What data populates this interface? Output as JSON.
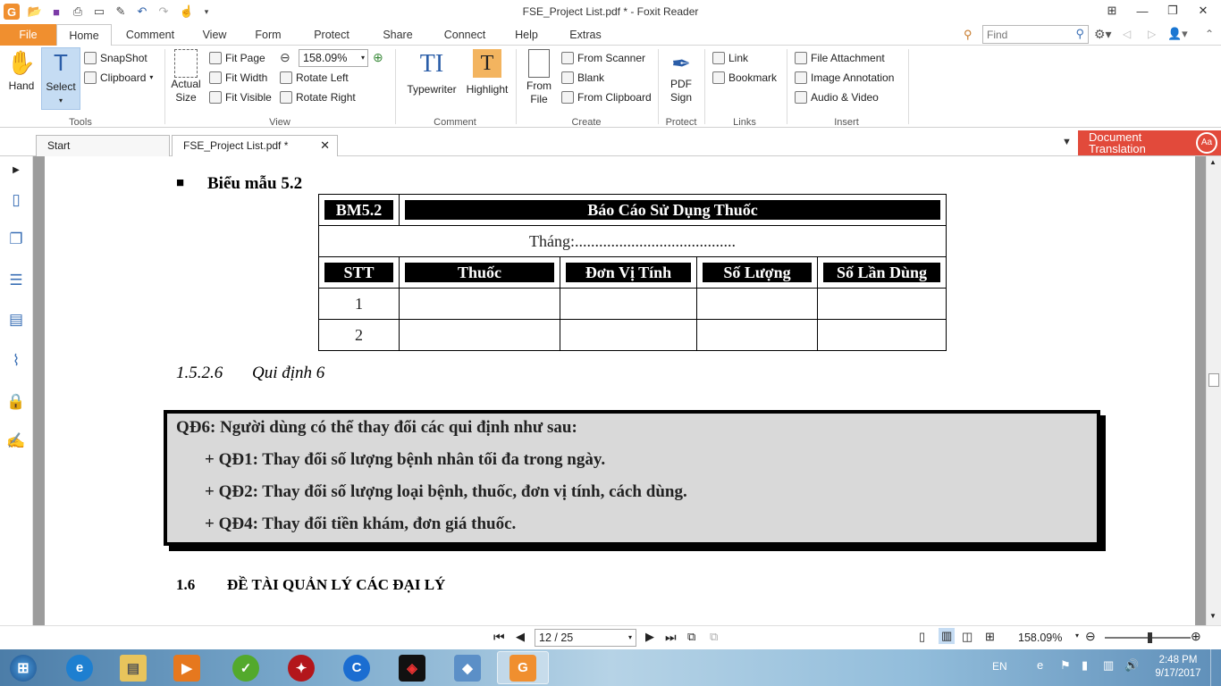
{
  "window": {
    "title": "FSE_Project List.pdf * - Foxit Reader"
  },
  "menu": {
    "tabs": [
      "File",
      "Home",
      "Comment",
      "View",
      "Form",
      "Protect",
      "Share",
      "Connect",
      "Help",
      "Extras"
    ],
    "find_placeholder": "Find"
  },
  "ribbon": {
    "hand": "Hand",
    "select": "Select",
    "snapshot": "SnapShot",
    "clipboard": "Clipboard",
    "actual_size_l1": "Actual",
    "actual_size_l2": "Size",
    "fit_page": "Fit Page",
    "fit_width": "Fit Width",
    "fit_visible": "Fit Visible",
    "zoom_value": "158.09%",
    "rotate_left": "Rotate Left",
    "rotate_right": "Rotate Right",
    "typewriter": "Typewriter",
    "highlight": "Highlight",
    "from_file_l1": "From",
    "from_file_l2": "File",
    "from_scanner": "From Scanner",
    "blank": "Blank",
    "from_clipboard": "From Clipboard",
    "pdf_sign_l1": "PDF",
    "pdf_sign_l2": "Sign",
    "link": "Link",
    "bookmark": "Bookmark",
    "file_attachment": "File Attachment",
    "image_annotation": "Image Annotation",
    "audio_video": "Audio & Video",
    "groups": {
      "tools": "Tools",
      "view": "View",
      "comment": "Comment",
      "create": "Create",
      "protect": "Protect",
      "links": "Links",
      "insert": "Insert"
    }
  },
  "doctabs": {
    "start": "Start",
    "current": "FSE_Project List.pdf *",
    "translation_l1": "Document",
    "translation_l2": "Translation"
  },
  "doc": {
    "bullet": "■",
    "heading": "Biểu mẫu 5.2",
    "form_code": "BM5.2",
    "form_title": "Báo Cáo Sử Dụng Thuốc",
    "month_line": "Tháng:........................................",
    "columns": [
      "STT",
      "Thuốc",
      "Đơn Vị Tính",
      "Số Lượng",
      "Số Lần Dùng"
    ],
    "rows": [
      "1",
      "2"
    ],
    "section_num": "1.5.2.6",
    "section_title": "Qui định 6",
    "qd6": "QĐ6: Người dùng có thể thay đổi các qui định như sau:",
    "qd1": "+ QĐ1: Thay đổi số lượng bệnh nhân tối đa trong ngày.",
    "qd2": "+ QĐ2: Thay đổi số lượng loại bệnh, thuốc, đơn vị tính, cách dùng.",
    "qd4": "+ QĐ4: Thay đổi tiền khám, đơn giá thuốc.",
    "h16_num": "1.6",
    "h16_title": "ĐỀ TÀI QUẢN LÝ CÁC ĐẠI LÝ"
  },
  "status": {
    "page": "12 / 25",
    "zoom": "158.09%"
  },
  "taskbar": {
    "lang": "EN",
    "time": "2:48 PM",
    "date": "9/17/2017"
  },
  "colors": {
    "file_tab": "#f08f2f",
    "doc_translation": "#e24a3b",
    "qd_box": "#d9d9d9",
    "doc_bg": "#9c9c9c"
  }
}
